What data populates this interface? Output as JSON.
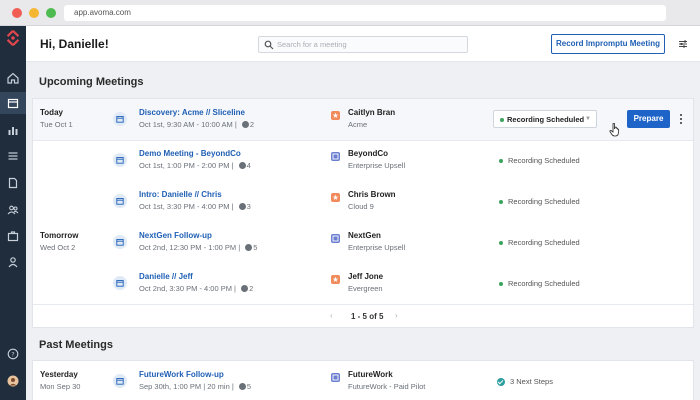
{
  "browser": {
    "url": "app.avoma.com"
  },
  "header": {
    "greeting": "Hi, Danielle!",
    "search_placeholder": "Search for a meeting",
    "record_button": "Record Impromptu Meeting"
  },
  "colors": {
    "accent": "#1e64c8",
    "sidebar": "#1f2d3d",
    "status_green": "#3ba55d",
    "logo": "#e0474c"
  },
  "sidebar": {
    "icons": [
      "home-icon",
      "calendar-icon",
      "chart-icon",
      "list-icon",
      "document-icon",
      "people-icon",
      "briefcase-icon",
      "user-icon",
      "help-icon",
      "avatar"
    ],
    "active": "calendar-icon"
  },
  "upcoming": {
    "title": "Upcoming Meetings",
    "rows": [
      {
        "day": "Today",
        "date": "Tue Oct 1",
        "title": "Discovery: Acme // Sliceline",
        "time": "Oct 1st, 9:30 AM - 10:00 AM",
        "attendees": "2",
        "company": "Caitlyn Bran",
        "sub": "Acme",
        "status": "Recording Scheduled",
        "action": "Prepare"
      },
      {
        "day": "",
        "date": "",
        "title": "Demo Meeting - BeyondCo",
        "time": "Oct 1st, 1:00 PM - 2:00 PM",
        "attendees": "4",
        "company": "BeyondCo",
        "sub": "Enterprise Upsell",
        "status": "Recording Scheduled"
      },
      {
        "day": "",
        "date": "",
        "title": "Intro: Danielle // Chris",
        "time": "Oct 1st, 3:30 PM - 4:00 PM",
        "attendees": "3",
        "company": "Chris Brown",
        "sub": "Cloud 9",
        "status": "Recording Scheduled"
      },
      {
        "day": "Tomorrow",
        "date": "Wed Oct 2",
        "title": "NextGen Follow-up",
        "time": "Oct 2nd, 12:30 PM - 1:00 PM",
        "attendees": "5",
        "company": "NextGen",
        "sub": "Enterprise Upsell",
        "status": "Recording Scheduled"
      },
      {
        "day": "",
        "date": "",
        "title": "Danielle // Jeff",
        "time": "Oct 2nd, 3:30 PM - 4:00 PM",
        "attendees": "2",
        "company": "Jeff Jone",
        "sub": "Evergreen",
        "status": "Recording Scheduled"
      }
    ],
    "pager": "1 - 5 of 5"
  },
  "past": {
    "title": "Past Meetings",
    "rows": [
      {
        "day": "Yesterday",
        "date": "Mon Sep 30",
        "title": "FutureWork Follow-up",
        "time": "Sep 30th, 1:00 PM | 20 min",
        "attendees": "5",
        "company": "FutureWork",
        "sub": "FutureWork - Paid Pilot",
        "status": "3 Next Steps"
      }
    ]
  }
}
